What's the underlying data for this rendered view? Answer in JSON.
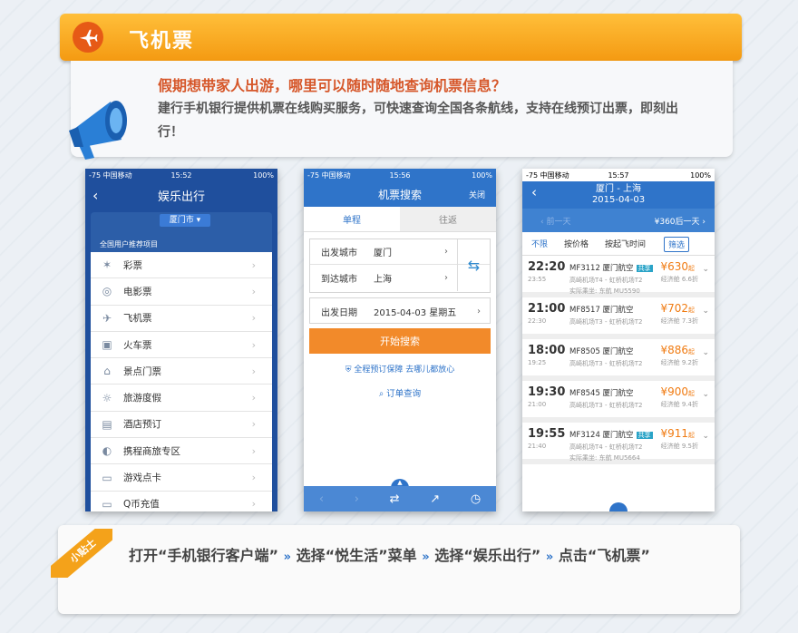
{
  "header": {
    "title": "飞机票"
  },
  "intro": {
    "heading": "假期想带家人出游，哪里可以随时随地查询机票信息？",
    "body": "建行手机银行提供机票在线购买服务，可快速查询全国各条航线，支持在线预订出票，即刻出行！"
  },
  "phone1": {
    "status": {
      "carrier": "-75 中国移动",
      "time": "15:52",
      "battery": "100%"
    },
    "nav": {
      "back": "‹",
      "title": "娱乐出行"
    },
    "city": "厦门市 ▾",
    "section": "全国用户推荐项目",
    "items": [
      {
        "label": "彩票",
        "icon": "✶"
      },
      {
        "label": "电影票",
        "icon": "◎"
      },
      {
        "label": "飞机票",
        "icon": "✈"
      },
      {
        "label": "火车票",
        "icon": "▣"
      },
      {
        "label": "景点门票",
        "icon": "⌂"
      },
      {
        "label": "旅游度假",
        "icon": "☼"
      },
      {
        "label": "酒店预订",
        "icon": "▤"
      },
      {
        "label": "携程商旅专区",
        "icon": "◐"
      },
      {
        "label": "游戏点卡",
        "icon": "▭"
      },
      {
        "label": "Q币充值",
        "icon": "▭"
      }
    ]
  },
  "phone2": {
    "status": {
      "carrier": "-75 中国移动",
      "time": "15:56",
      "battery": "100%"
    },
    "nav": {
      "title": "机票搜索",
      "close": "关闭"
    },
    "tabs": [
      "单程",
      "往返"
    ],
    "depart_label": "出发城市",
    "depart_value": "厦门",
    "arrive_label": "到达城市",
    "arrive_value": "上海",
    "date_label": "出发日期",
    "date_value": "2015-04-03 星期五",
    "search_btn": "开始搜索",
    "guarantee": "全程预订保障 去哪儿都放心",
    "order_query": "订单查询"
  },
  "phone3": {
    "status": {
      "carrier": "-75 中国移动",
      "time": "15:57",
      "battery": "100%"
    },
    "nav": {
      "route": "厦门 - 上海",
      "date": "2015-04-03"
    },
    "days": {
      "prev": "前一天",
      "next": "¥360后一天"
    },
    "filters": {
      "all": "不限",
      "price": "按价格",
      "time": "按起飞时间",
      "screen": "筛选"
    },
    "flights": [
      {
        "dep": "22:20",
        "arr": "23:55",
        "no": "MF3112 厦门航空",
        "share": "共享",
        "airport": "高崎机场T4 - 虹桥机场T2",
        "real": "实际乘坐: 东航 MU5590",
        "price": "¥630",
        "cls": "经济舱 6.6折"
      },
      {
        "dep": "21:00",
        "arr": "22:30",
        "no": "MF8517 厦门航空",
        "share": "",
        "airport": "高崎机场T3 - 虹桥机场T2",
        "real": "",
        "price": "¥702",
        "cls": "经济舱 7.3折"
      },
      {
        "dep": "18:00",
        "arr": "19:25",
        "no": "MF8505 厦门航空",
        "share": "",
        "airport": "高崎机场T3 - 虹桥机场T2",
        "real": "",
        "price": "¥886",
        "cls": "经济舱 9.2折"
      },
      {
        "dep": "19:30",
        "arr": "21:00",
        "no": "MF8545 厦门航空",
        "share": "",
        "airport": "高崎机场T3 - 虹桥机场T2",
        "real": "",
        "price": "¥900",
        "cls": "经济舱 9.4折"
      },
      {
        "dep": "19:55",
        "arr": "21:40",
        "no": "MF3124 厦门航空",
        "share": "共享",
        "airport": "高崎机场T4 - 虹桥机场T2",
        "real": "实际乘坐: 东航 MU5664",
        "price": "¥911",
        "cls": "经济舱 9.5折"
      }
    ],
    "price_suffix": "起"
  },
  "tip": {
    "badge": "小贴士",
    "step1": "打开“手机银行客户端”",
    "step2": "选择“悦生活”菜单",
    "step3": "选择“娱乐出行”",
    "step4": "点击“飞机票”",
    "sep": "»"
  },
  "colors": {
    "brand_blue": "#2f74c9",
    "accent_orange": "#f49a12",
    "price_orange": "#f07b12"
  }
}
